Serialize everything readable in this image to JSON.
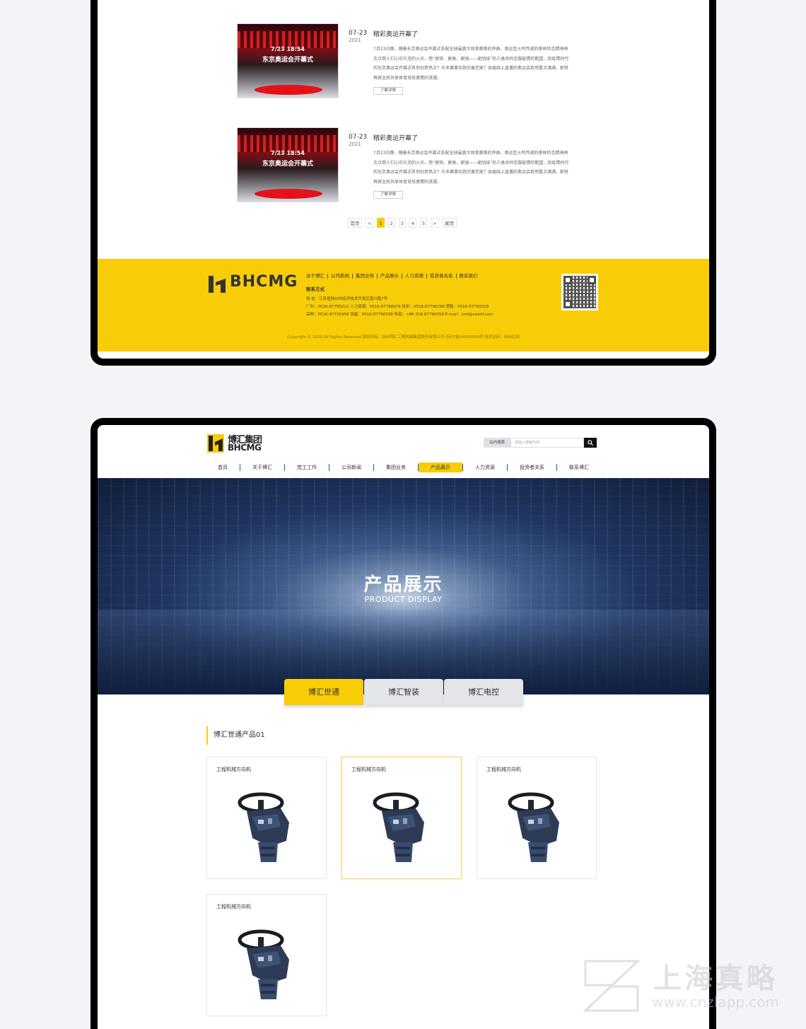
{
  "news": {
    "items": [
      {
        "thumb_line1": "7/23 18:54",
        "thumb_line2": "东京奥运会开幕式",
        "date": "07-23",
        "year": "2021",
        "title": "精彩奥运开幕了",
        "body": "7月23日晚，随着东京奥运会开幕式各配全球最盛大体育赛事的序曲，奥运圣火所传递的奥林匹克精神再次点燃人们心中久违的火光，用“更快、更高、更强——更团结”的人类共同克服疫情的期望。后疫情时代的东京奥运会开幕式有何创意亮点？众多赛事实践完善您家？本届线上直播的奥运会依然看点满满，即将再掀全民共享体育竞技激情的浪潮。",
        "more": "了解详情"
      },
      {
        "thumb_line1": "7/23 18:54",
        "thumb_line2": "东京奥运会开幕式",
        "date": "07-23",
        "year": "2021",
        "title": "精彩奥运开幕了",
        "body": "7月23日晚，随着东京奥运会开幕式各配全球最盛大体育赛事的序曲，奥运圣火所传递的奥林匹克精神再次点燃人们心中久违的火光，用“更快、更高、更强——更团结”的人类共同克服疫情的期望。后疫情时代的东京奥运会开幕式有何创意亮点？众多赛事实践完善您家？本届线上直播的奥运会依然看点满满，即将再掀全民共享体育竞技激情的浪潮。",
        "more": "了解详情"
      }
    ]
  },
  "pager": {
    "first": "首页",
    "prev": "<",
    "pages": [
      "1",
      "2",
      "3",
      "4",
      "5"
    ],
    "active": "1",
    "next": ">",
    "last": "尾页"
  },
  "footer": {
    "logo_text": "BHCMG",
    "nav": [
      "关于博汇",
      "公司新闻",
      "集团业务",
      "产品展示",
      "人力资源",
      "投资者关系",
      "联系我们"
    ],
    "contact_title": "联系方式",
    "address": "地 址：江苏省徐州市经济技术开发区南川路7号",
    "line2": "厂办：0516-87790222   人力资源：0516-87798078   技术：0516-87790298   销售：0516-87790018",
    "line3": "采购：0516-87735958   设备：0516-87790038   传真：+86-516-87790058   E-mail：smf@xzsmf.com",
    "copyright": "Copyright © 2020 All Rights Reserved 版权所有：徐州博汇工程机械集团股份有限公司 苏ICP备14059099号 技术支持：徐州亿网"
  },
  "header": {
    "logo_cn": "博汇集团",
    "logo_en": "BHCMG",
    "search_label": "站内搜索",
    "search_placeholder": "请输入搜索内容",
    "search_button": "search-icon"
  },
  "nav": {
    "items": [
      "首页",
      "关于博汇",
      "党工工作",
      "公司新闻",
      "集团业务",
      "产品展示",
      "人力资源",
      "投资者关系",
      "联系博汇"
    ],
    "active": "产品展示"
  },
  "banner": {
    "title": "产品展示",
    "subtitle": "PRODUCT DISPLAY"
  },
  "tabs": {
    "items": [
      "博汇世通",
      "博汇智装",
      "博汇电控"
    ],
    "active": "博汇世通"
  },
  "section": {
    "title": "博汇世通产品01"
  },
  "products": [
    {
      "name": "工程机械方向机"
    },
    {
      "name": "工程机械方向机"
    },
    {
      "name": "工程机械方向机"
    },
    {
      "name": "工程机械方向机"
    }
  ],
  "watermark": {
    "cn": "上海真略",
    "url": "www.cnzlapp.com"
  },
  "colors": {
    "accent": "#f8cd07",
    "nav_separator": "#1a5bd8",
    "device_frame": "#000000",
    "page_bg": "#f3f4f8"
  }
}
